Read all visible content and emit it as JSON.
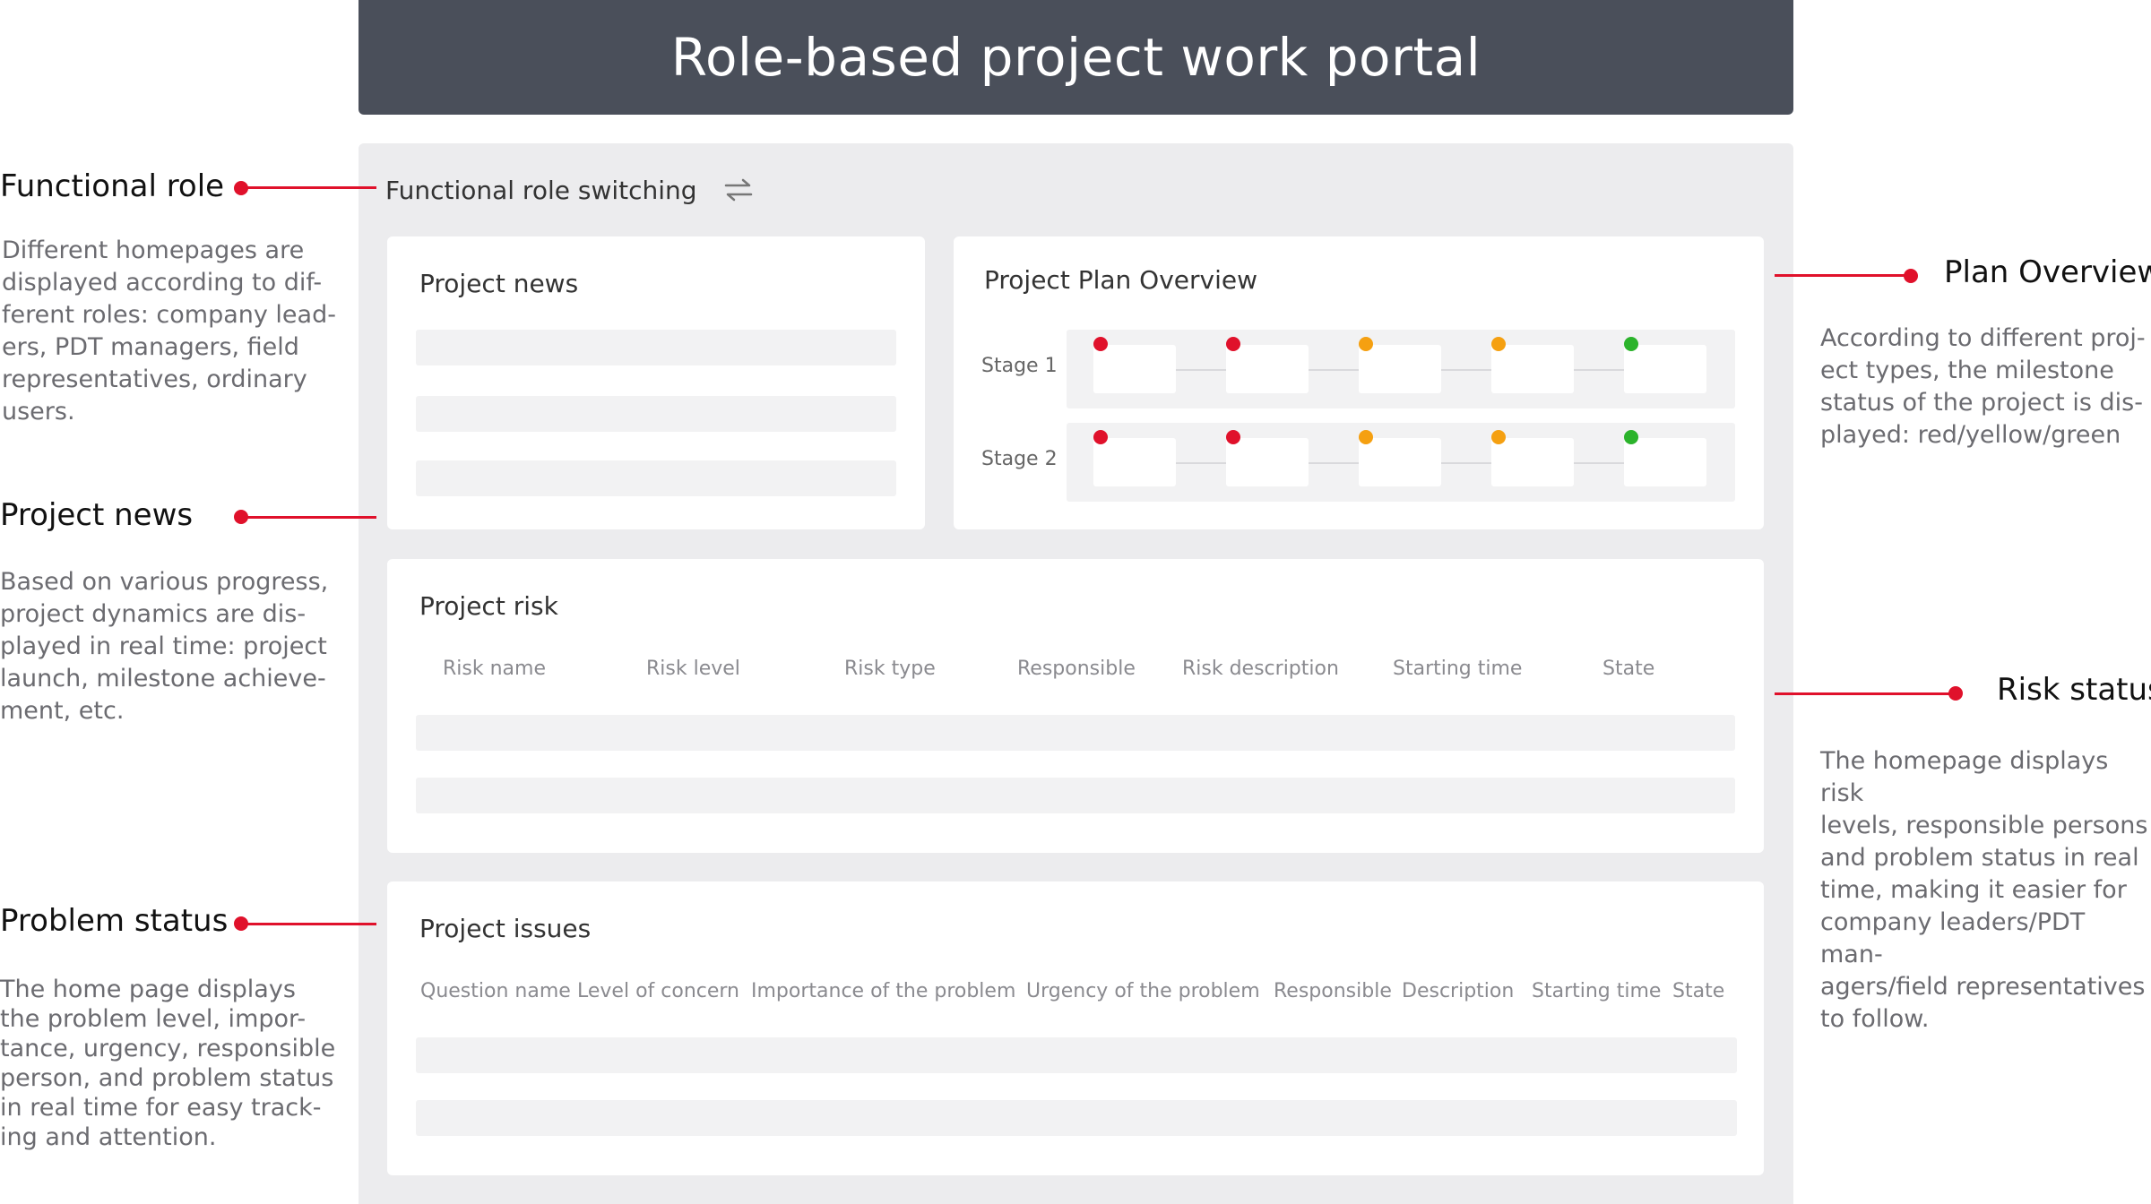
{
  "title": "Role-based project work portal",
  "role_switch": {
    "label": "Functional role switching",
    "icon": "swap-arrows-icon"
  },
  "news_card": {
    "title": "Project news"
  },
  "plan_card": {
    "title": "Project Plan Overview",
    "stages": [
      {
        "label": "Stage 1",
        "milestones": [
          "red",
          "red",
          "yellow",
          "yellow",
          "green"
        ]
      },
      {
        "label": "Stage 2",
        "milestones": [
          "red",
          "red",
          "yellow",
          "yellow",
          "green"
        ]
      }
    ],
    "colors": {
      "red": "#e0112b",
      "yellow": "#f5a011",
      "green": "#2bb32b"
    }
  },
  "risk_card": {
    "title": "Project risk",
    "columns": [
      "Risk name",
      "Risk level",
      "Risk type",
      "Responsible",
      "Risk description",
      "Starting time",
      "State"
    ]
  },
  "issues_card": {
    "title": "Project issues",
    "columns": [
      "Question name",
      "Level of concern",
      "Importance of the problem",
      "Urgency of the problem",
      "Responsible",
      "Description",
      "Starting time",
      "State"
    ]
  },
  "annotations": {
    "functional_role": {
      "title": "Functional role",
      "description": "Different homepages are\ndisplayed according to dif-\nferent roles: company lead-\ners, PDT managers, field\nrepresentatives, ordinary\nusers."
    },
    "project_news": {
      "title": "Project news",
      "description": "Based on various progress,\nproject dynamics are dis-\nplayed in real time: project\nlaunch, milestone achieve-\nment, etc."
    },
    "problem_status": {
      "title": "Problem status",
      "description": "The home page displays\nthe problem level, impor-\ntance, urgency, responsible\nperson, and problem status\nin real time for easy track-\ning and attention."
    },
    "plan_overview": {
      "title": "Plan Overview",
      "description": "According to different proj-\nect types, the milestone\nstatus of the project is dis-\nplayed: red/yellow/green"
    },
    "risk_status": {
      "title": "Risk status",
      "description": "The homepage displays risk\nlevels, responsible persons\nand problem status in real\ntime, making it easier for\ncompany leaders/PDT man-\nagers/field representatives\nto follow."
    },
    "accent_color": "#e0112b"
  }
}
